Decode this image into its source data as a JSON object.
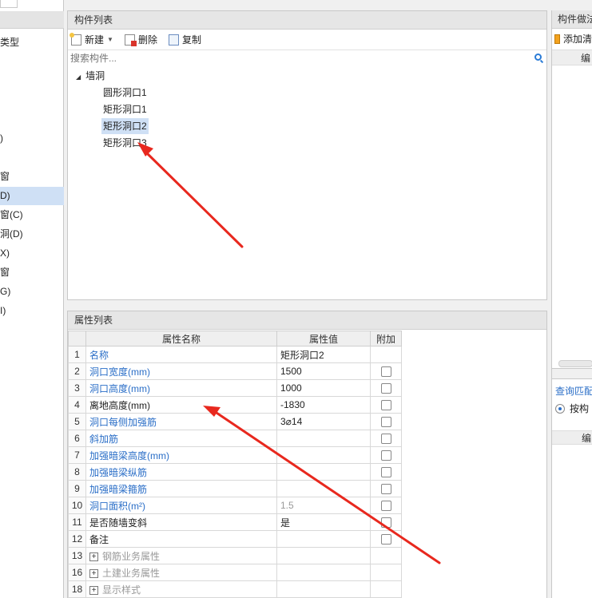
{
  "left_panel": {
    "header_label": "类型",
    "items": [
      ")",
      "窗",
      "D)",
      "窗(C)",
      "洞(D)",
      "X)",
      "窗",
      "G)",
      "I)"
    ]
  },
  "component_list": {
    "title": "构件列表",
    "toolbar": {
      "new_label": "新建",
      "delete_label": "删除",
      "copy_label": "复制"
    },
    "search_placeholder": "搜索构件...",
    "tree": {
      "root_label": "墙洞",
      "children": [
        "圆形洞口1",
        "矩形洞口1",
        "矩形洞口2",
        "矩形洞口3"
      ],
      "selected_index": 2
    }
  },
  "right_panel": {
    "title": "构件做法",
    "add_label": "添加清",
    "col_label": "编",
    "query_label": "查询匹配",
    "radio_label": "按构",
    "col2_label": "编"
  },
  "property_list": {
    "title": "属性列表",
    "columns": {
      "num": "",
      "name": "属性名称",
      "value": "属性值",
      "extra": "附加"
    },
    "rows": [
      {
        "num": "1",
        "name": "名称",
        "value": "矩形洞口2",
        "checkbox": false
      },
      {
        "num": "2",
        "name": "洞口宽度(mm)",
        "value": "1500",
        "checkbox": true
      },
      {
        "num": "3",
        "name": "洞口高度(mm)",
        "value": "1000",
        "checkbox": true
      },
      {
        "num": "4",
        "name": "离地高度(mm)",
        "value": "-1830",
        "checkbox": true
      },
      {
        "num": "5",
        "name": "洞口每侧加强筋",
        "value": "3⌀14",
        "checkbox": true
      },
      {
        "num": "6",
        "name": "斜加筋",
        "value": "",
        "checkbox": true
      },
      {
        "num": "7",
        "name": "加强暗梁高度(mm)",
        "value": "",
        "checkbox": true
      },
      {
        "num": "8",
        "name": "加强暗梁纵筋",
        "value": "",
        "checkbox": true
      },
      {
        "num": "9",
        "name": "加强暗梁箍筋",
        "value": "",
        "checkbox": true
      },
      {
        "num": "10",
        "name": "洞口面积(m²)",
        "value": "1.5",
        "checkbox": true
      },
      {
        "num": "11",
        "name": "是否随墙变斜",
        "value": "是",
        "checkbox": true
      },
      {
        "num": "12",
        "name": "备注",
        "value": "",
        "checkbox": true
      },
      {
        "num": "13",
        "name": "钢筋业务属性",
        "value": "",
        "checkbox": false
      },
      {
        "num": "16",
        "name": "土建业务属性",
        "value": "",
        "checkbox": false
      },
      {
        "num": "18",
        "name": "显示样式",
        "value": "",
        "checkbox": false
      }
    ]
  },
  "colors": {
    "accent_blue": "#2a6ec7",
    "arrow_red": "#e8281e",
    "selection": "#cfe0f5"
  }
}
